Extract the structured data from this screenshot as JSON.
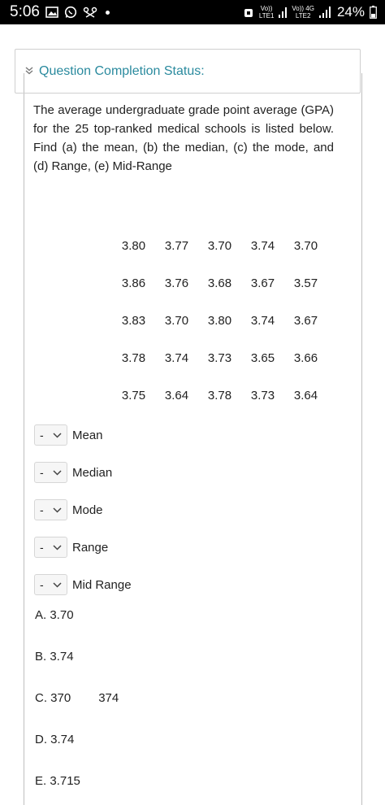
{
  "status_bar": {
    "time": "5:06",
    "net1_top": "Vo))",
    "net1_bottom": "LTE1",
    "net2_top": "Vo)) 4G",
    "net2_bottom": "LTE2",
    "battery": "24%"
  },
  "header": {
    "status_title": "Question Completion Status:"
  },
  "question": {
    "text": "The average undergraduate grade point average (GPA) for the 25 top-ranked medical schools is listed below. Find (a) the mean, (b) the median, (c) the mode, and (d) Range, (e) Mid-Range"
  },
  "data_rows": [
    [
      "3.80",
      "3.77",
      "3.70",
      "3.74",
      "3.70"
    ],
    [
      "3.86",
      "3.76",
      "3.68",
      "3.67",
      "3.57"
    ],
    [
      "3.83",
      "3.70",
      "3.80",
      "3.74",
      "3.67"
    ],
    [
      "3.78",
      "3.74",
      "3.73",
      "3.65",
      "3.66"
    ],
    [
      "3.75",
      "3.64",
      "3.78",
      "3.73",
      "3.64"
    ]
  ],
  "answers": [
    {
      "selected": "-",
      "label": "Mean"
    },
    {
      "selected": "-",
      "label": "Median"
    },
    {
      "selected": "-",
      "label": "Mode"
    },
    {
      "selected": "-",
      "label": "Range"
    },
    {
      "selected": "-",
      "label": "Mid Range"
    }
  ],
  "options": {
    "a": "A. 3.70",
    "b": "B. 3.74",
    "c": "C. 370",
    "c_extra": "374",
    "d": "D. 3.74",
    "e": "E. 3.715"
  }
}
